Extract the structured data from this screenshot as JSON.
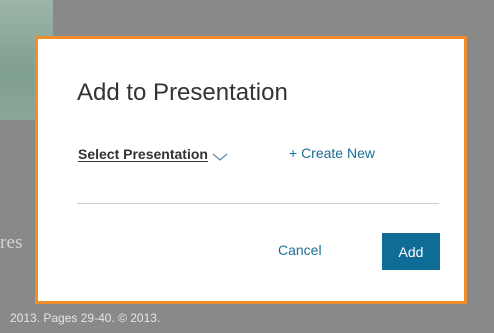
{
  "background": {
    "partial_text": "res",
    "footer_text": "2013. Pages 29-40. © 2013."
  },
  "modal": {
    "title": "Add to Presentation",
    "select_label": "Select Presentation",
    "create_new_label": "+ Create New",
    "cancel_label": "Cancel",
    "add_label": "Add"
  },
  "colors": {
    "modal_border": "#ee8d2a",
    "link": "#1a6f96",
    "primary_button": "#0e6c97",
    "overlay": "#898989"
  },
  "icons": {
    "select_chevron": "chevron-down-icon"
  }
}
